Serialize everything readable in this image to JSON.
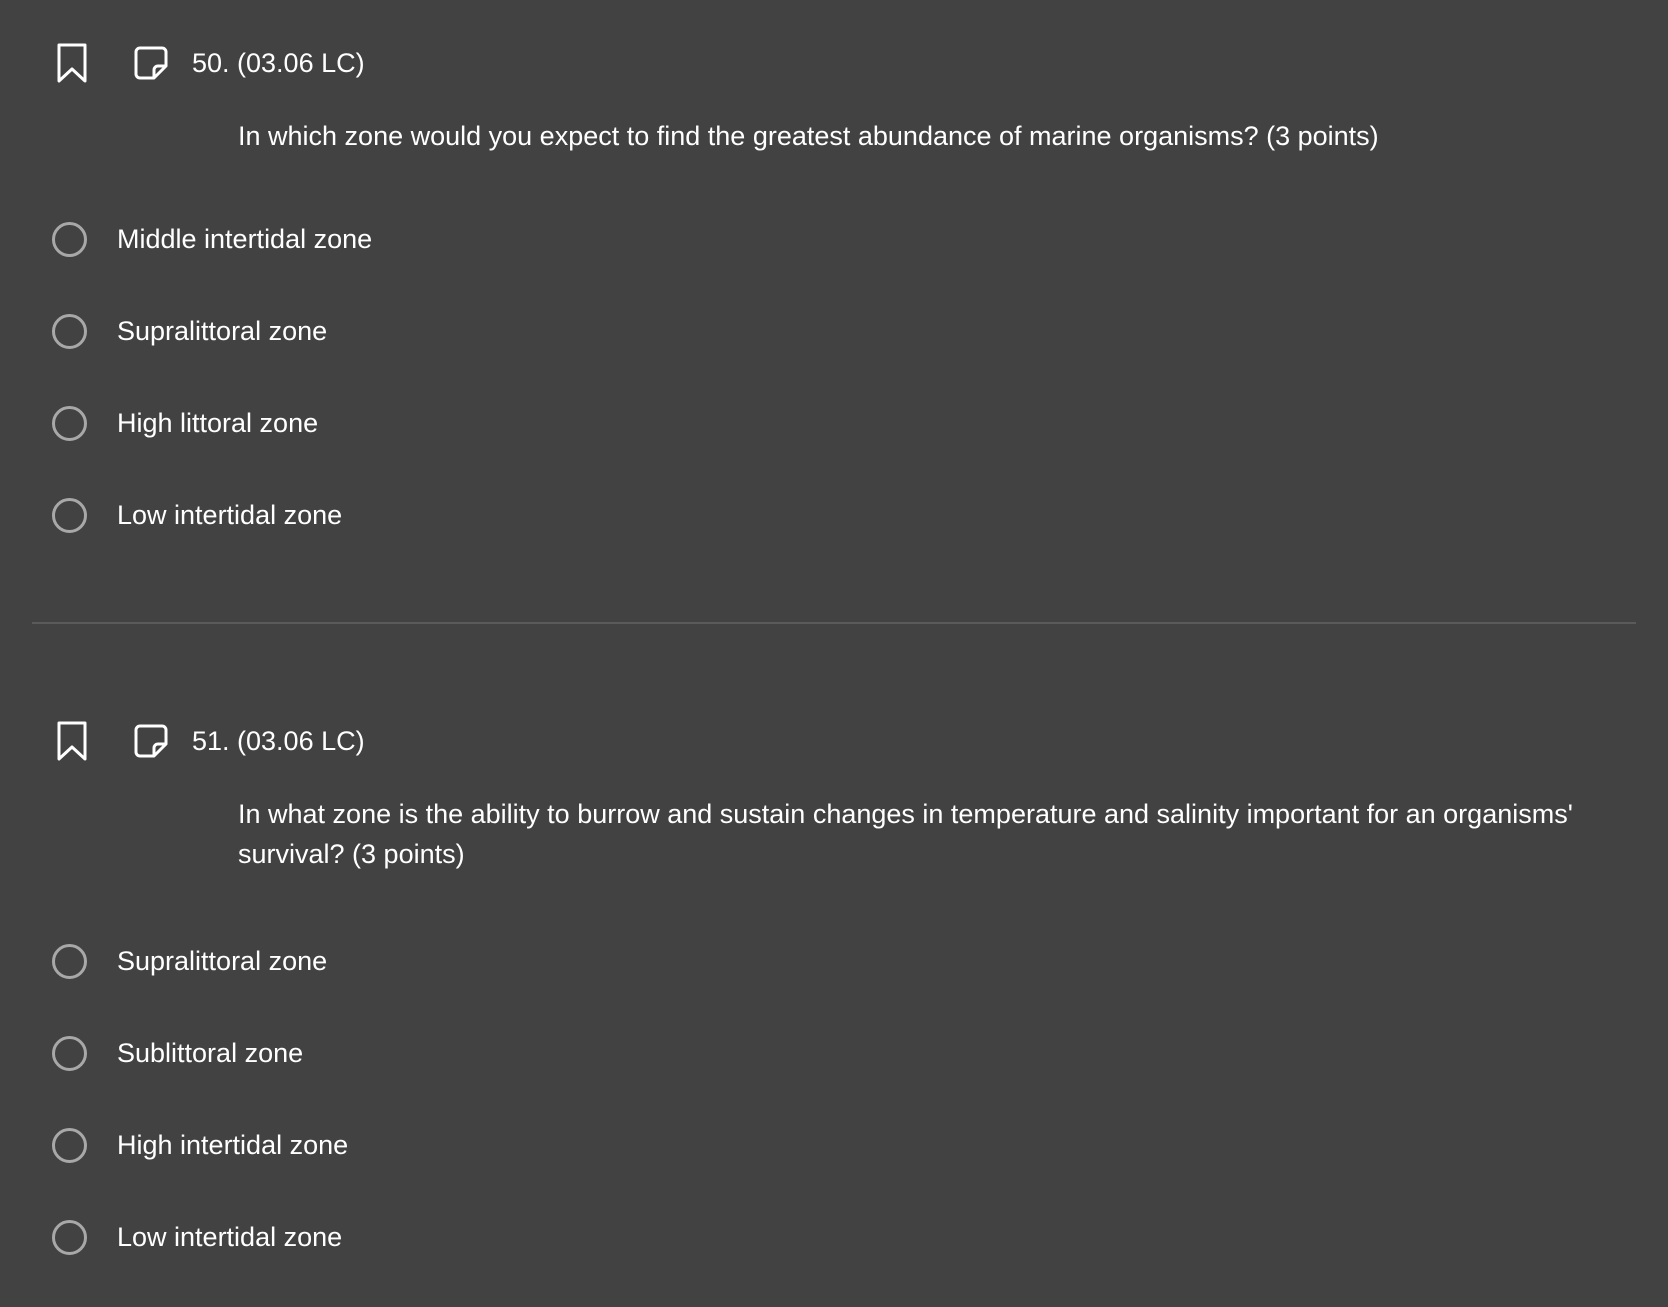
{
  "questions": [
    {
      "number": "50. (03.06 LC)",
      "prompt": "In which zone would you expect to find the greatest abundance of marine organisms? (3 points)",
      "options": [
        "Middle intertidal zone",
        "Supralittoral zone",
        "High littoral zone",
        "Low intertidal zone"
      ]
    },
    {
      "number": "51. (03.06 LC)",
      "prompt": "In what zone is the ability to burrow and sustain changes in temperature and salinity important for an organisms' survival? (3 points)",
      "options": [
        "Supralittoral zone",
        "Sublittoral zone",
        "High intertidal zone",
        "Low intertidal zone"
      ]
    }
  ],
  "icons": {
    "bookmark": "bookmark-icon",
    "note": "note-icon",
    "radio": "radio-unchecked-icon"
  },
  "colors": {
    "background": "#424242",
    "text": "#ffffff",
    "radio_border": "#a8a8a8",
    "divider": "#5a5a5a"
  }
}
